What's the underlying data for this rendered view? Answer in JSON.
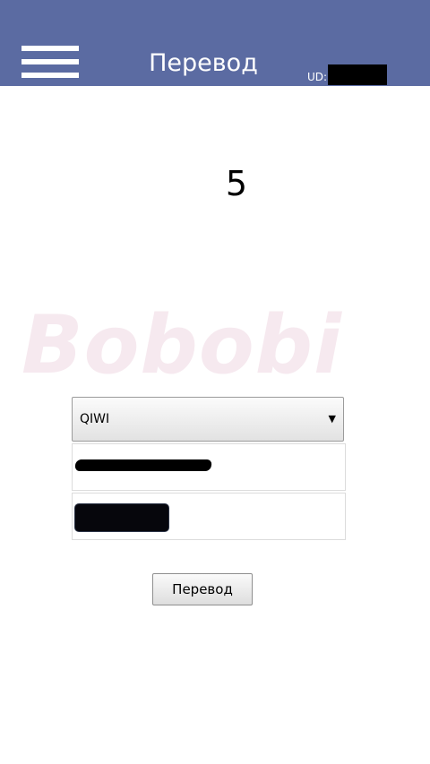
{
  "header": {
    "title": "Перевод",
    "ud_label": "UD:",
    "ud_value": "",
    "background": "#5b6ba2",
    "menu_icon": "hamburger-menu-icon"
  },
  "main": {
    "amount": "5",
    "watermark": "Bobobi"
  },
  "form": {
    "payment_system": {
      "selected": "QIWI",
      "arrow_icon": "triangle-down-icon"
    },
    "field_1": {
      "value": ""
    },
    "field_2": {
      "value": ""
    },
    "submit_label": "Перевод"
  }
}
